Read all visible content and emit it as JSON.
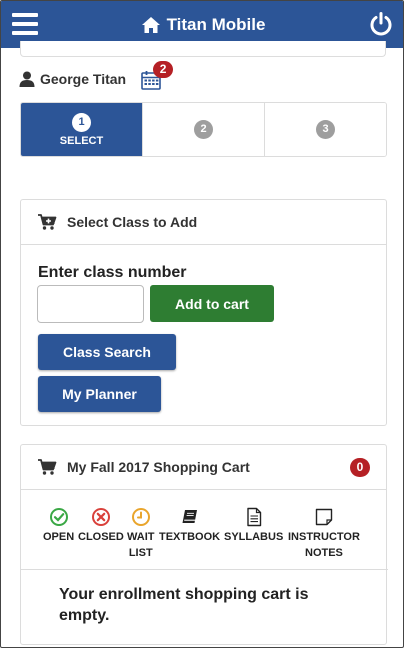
{
  "header": {
    "title": "Titan Mobile",
    "menu_icon": "hamburger-icon",
    "home_icon": "home-icon",
    "power_icon": "power-icon",
    "brand_color": "#2c5597"
  },
  "user": {
    "name": "George Titan",
    "user_icon": "user-icon",
    "calendar_icon": "calendar-icon",
    "calendar_badge": "2"
  },
  "steps": [
    {
      "number": "1",
      "label": "SELECT",
      "active": true
    },
    {
      "number": "2",
      "label": "",
      "active": false
    },
    {
      "number": "3",
      "label": "",
      "active": false
    }
  ],
  "add_class": {
    "title": "Select Class to Add",
    "icon": "cart-plus-icon",
    "input_label": "Enter class number",
    "input_value": "",
    "input_placeholder": "",
    "add_button": "Add to cart",
    "class_search_button": "Class Search",
    "planner_button": "My Planner"
  },
  "cart": {
    "title": "My Fall 2017 Shopping Cart",
    "icon": "shopping-cart-icon",
    "count": "0",
    "legend": [
      {
        "label": "OPEN",
        "icon": "open-check-icon",
        "color": "#3aa845"
      },
      {
        "label": "CLOSED",
        "icon": "closed-x-icon",
        "color": "#d9413b"
      },
      {
        "label": "WAIT\nLIST",
        "icon": "waitlist-clock-icon",
        "color": "#e9a52c"
      },
      {
        "label": "TEXTBOOK",
        "icon": "textbook-icon",
        "color": "#222222"
      },
      {
        "label": "SYLLABUS",
        "icon": "syllabus-icon",
        "color": "#222222"
      },
      {
        "label": "INSTRUCTOR\nNOTES",
        "icon": "instructor-notes-icon",
        "color": "#222222"
      }
    ],
    "empty_message": "Your enrollment shopping cart is empty."
  }
}
